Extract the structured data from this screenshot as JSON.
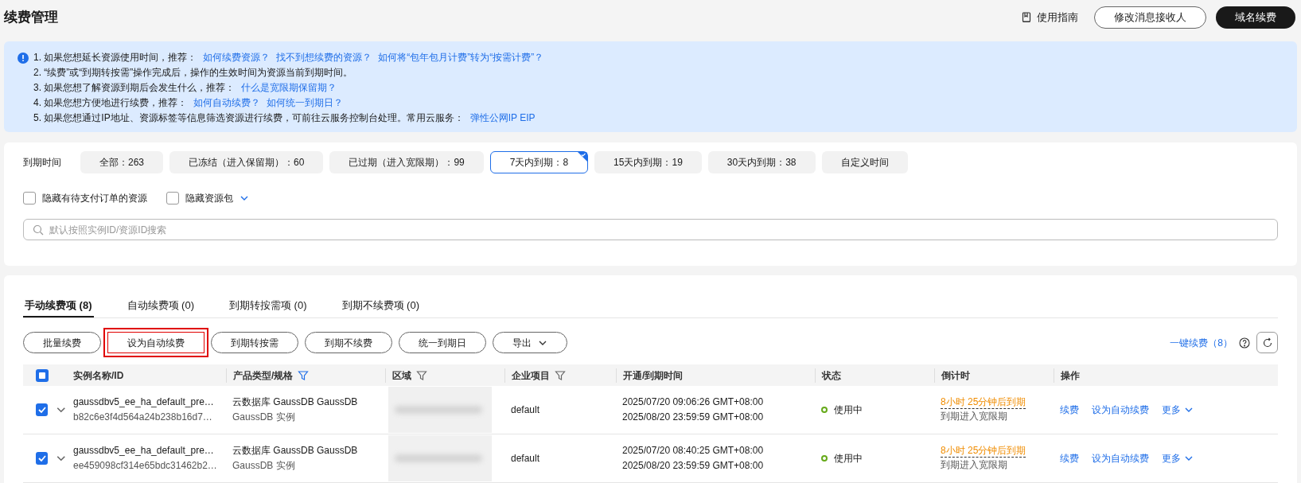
{
  "page_title": "续费管理",
  "header_actions": {
    "guide": "使用指南",
    "buttons": [
      {
        "label": "修改消息接收人",
        "kind": "outline"
      },
      {
        "label": "域名续费",
        "kind": "dark"
      }
    ]
  },
  "notice": {
    "lines": [
      {
        "text": "1. 如果您想延长资源使用时间，推荐：",
        "links": [
          "如何续费资源？",
          "找不到想续费的资源？",
          "如何将“包年包月计费”转为“按需计费”？"
        ]
      },
      {
        "text": "2. “续费”或“到期转按需”操作完成后，操作的生效时间为资源当前到期时间。"
      },
      {
        "text": "3. 如果您想了解资源到期后会发生什么，推荐：",
        "links": [
          "什么是宽限期保留期？"
        ]
      },
      {
        "text": "4. 如果您想方便地进行续费，推荐：",
        "links": [
          "如何自动续费？",
          "如何统一到期日？"
        ]
      },
      {
        "text": "5. 如果您想通过IP地址、资源标签等信息筛选资源进行续费，可前往云服务控制台处理。常用云服务：",
        "links": [
          "弹性公网IP EIP"
        ]
      }
    ]
  },
  "filters": {
    "label": "到期时间",
    "chips": [
      {
        "label": "全部：263",
        "selected": false
      },
      {
        "label": "已冻结（进入保留期）：60",
        "selected": false
      },
      {
        "label": "已过期（进入宽限期）：99",
        "selected": false
      },
      {
        "label": "7天内到期：8",
        "selected": true
      },
      {
        "label": "15天内到期：19",
        "selected": false
      },
      {
        "label": "30天内到期：38",
        "selected": false
      },
      {
        "label": "自定义时间",
        "selected": false
      }
    ],
    "options": [
      {
        "label": "隐藏有待支付订单的资源",
        "checked": false,
        "kind": "plain"
      },
      {
        "label": "隐藏资源包",
        "checked": false,
        "kind": "menu"
      }
    ],
    "search": {
      "placeholder": "默认按照实例ID/资源ID搜索"
    }
  },
  "tabs": [
    {
      "label": "手动续费项 (8)",
      "selected": true
    },
    {
      "label": "自动续费项 (0)",
      "selected": false
    },
    {
      "label": "到期转按需项 (0)",
      "selected": false
    },
    {
      "label": "到期不续费项 (0)",
      "selected": false
    }
  ],
  "toolbar": {
    "buttons": [
      {
        "label": "批量续费",
        "highlighted": false,
        "kind": "plain"
      },
      {
        "label": "设为自动续费",
        "highlighted": true,
        "kind": "plain"
      },
      {
        "label": "到期转按需",
        "highlighted": false,
        "kind": "plain"
      },
      {
        "label": "到期不续费",
        "highlighted": false,
        "kind": "plain"
      },
      {
        "label": "统一到期日",
        "highlighted": false,
        "kind": "plain"
      },
      {
        "label": "导出",
        "highlighted": false,
        "kind": "menu"
      }
    ],
    "one_click": "一键续费（8）"
  },
  "table": {
    "select_all": {
      "indeterminate": true
    },
    "columns": [
      {
        "label": "实例名称/ID",
        "kind": "plain"
      },
      {
        "label": "产品类型/规格",
        "kind": "filterable",
        "filter_active": true
      },
      {
        "label": "区域",
        "kind": "filterable",
        "filter_active": false
      },
      {
        "label": "企业项目",
        "kind": "filterable",
        "filter_active": false
      },
      {
        "label": "开通/到期时间",
        "kind": "plain"
      },
      {
        "label": "状态",
        "kind": "plain"
      },
      {
        "label": "倒计时",
        "kind": "plain"
      },
      {
        "label": "操作",
        "kind": "plain"
      }
    ],
    "rows": [
      {
        "checked": true,
        "name": "gaussdbv5_ee_ha_default_pre…",
        "id": "b82c6e3f4d564a24b238b16d7…",
        "product": "云数据库 GaussDB GaussDB",
        "spec": "GaussDB 实例",
        "region_blurred": true,
        "project": "default",
        "opened": "2025/07/20 09:06:26 GMT+08:00",
        "expires": "2025/08/20 23:59:59 GMT+08:00",
        "status": "使用中",
        "countdown": "8小时 25分钟后到期",
        "countdown_note": "到期进入宽限期",
        "actions": [
          "续费",
          "设为自动续费",
          "更多"
        ]
      },
      {
        "checked": true,
        "name": "gaussdbv5_ee_ha_default_pre…",
        "id": "ee459098cf314e65bdc31462b2…",
        "product": "云数据库 GaussDB GaussDB",
        "spec": "GaussDB 实例",
        "region_blurred": true,
        "project": "default",
        "opened": "2025/07/20 08:40:25 GMT+08:00",
        "expires": "2025/08/20 23:59:59 GMT+08:00",
        "status": "使用中",
        "countdown": "8小时 25分钟后到期",
        "countdown_note": "到期进入宽限期",
        "actions": [
          "续费",
          "设为自动续费",
          "更多"
        ]
      }
    ]
  }
}
